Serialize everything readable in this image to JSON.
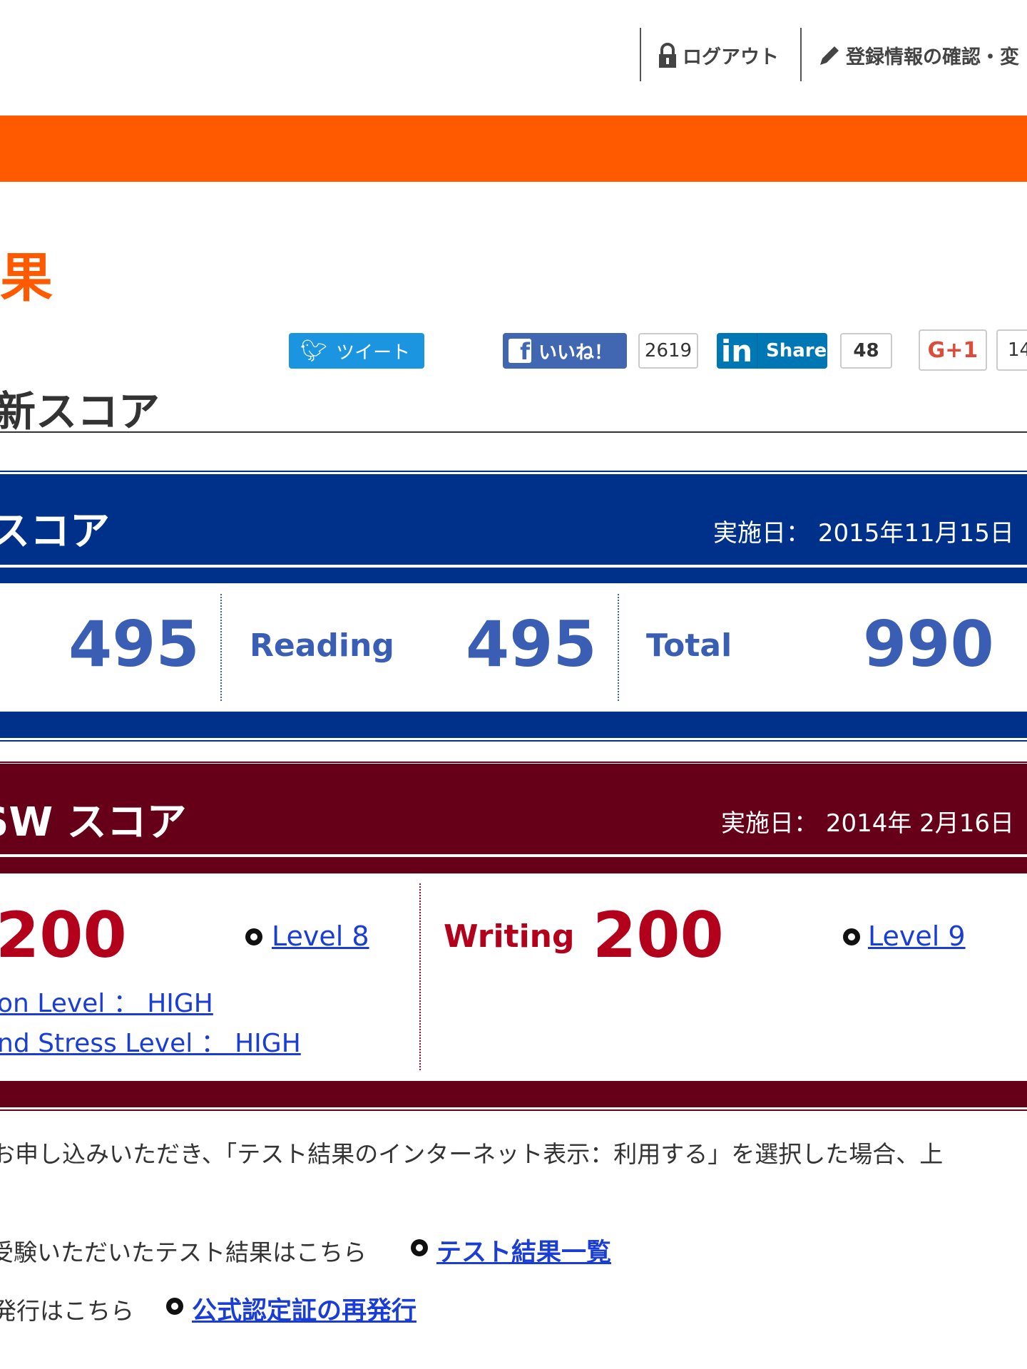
{
  "header": {
    "logout_label": "ログアウト",
    "account_label": "登録情報の確認・変"
  },
  "page": {
    "title_fragment": "果",
    "section_heading": "新スコア"
  },
  "colors": {
    "accent_orange": "#ff5a00",
    "listening_reading_blue": "#00318a",
    "speaking_writing_red": "#660019",
    "score_blue": "#3a5eb3",
    "score_red": "#b3001b",
    "link_blue": "#1a3dd6"
  },
  "social": {
    "tweet_label": "ツイート",
    "facebook_label": "いいね！",
    "facebook_count": "2619",
    "linkedin_label": "Share",
    "linkedin_count": "48",
    "gplus_label": "G+1",
    "gplus_count": "14"
  },
  "lr": {
    "title": "スコア",
    "date_label": "実施日：",
    "date": "2015年11月15日",
    "listening_score": "495",
    "reading_label": "Reading",
    "reading_score": "495",
    "total_label": "Total",
    "total_score": "990"
  },
  "sw": {
    "title": "SW スコア",
    "date_label": "実施日：",
    "date": "2014年 2月16日",
    "speaking_score": "200",
    "speaking_level": "Level 8",
    "level_line1": "on Level ： HIGH",
    "level_line2": "nd Stress Level ： HIGH",
    "writing_label": "Writing",
    "writing_score": "200",
    "writing_level": "Level 9"
  },
  "footer": {
    "note": "お申し込みいただき、「テスト結果のインターネット表示：利用する」を選択した場合、上",
    "results_text": "受験いただいたテスト結果はこちら",
    "results_link": "テスト結果一覧",
    "reissue_text": "発行はこちら",
    "reissue_link": "公式認定証の再発行"
  }
}
